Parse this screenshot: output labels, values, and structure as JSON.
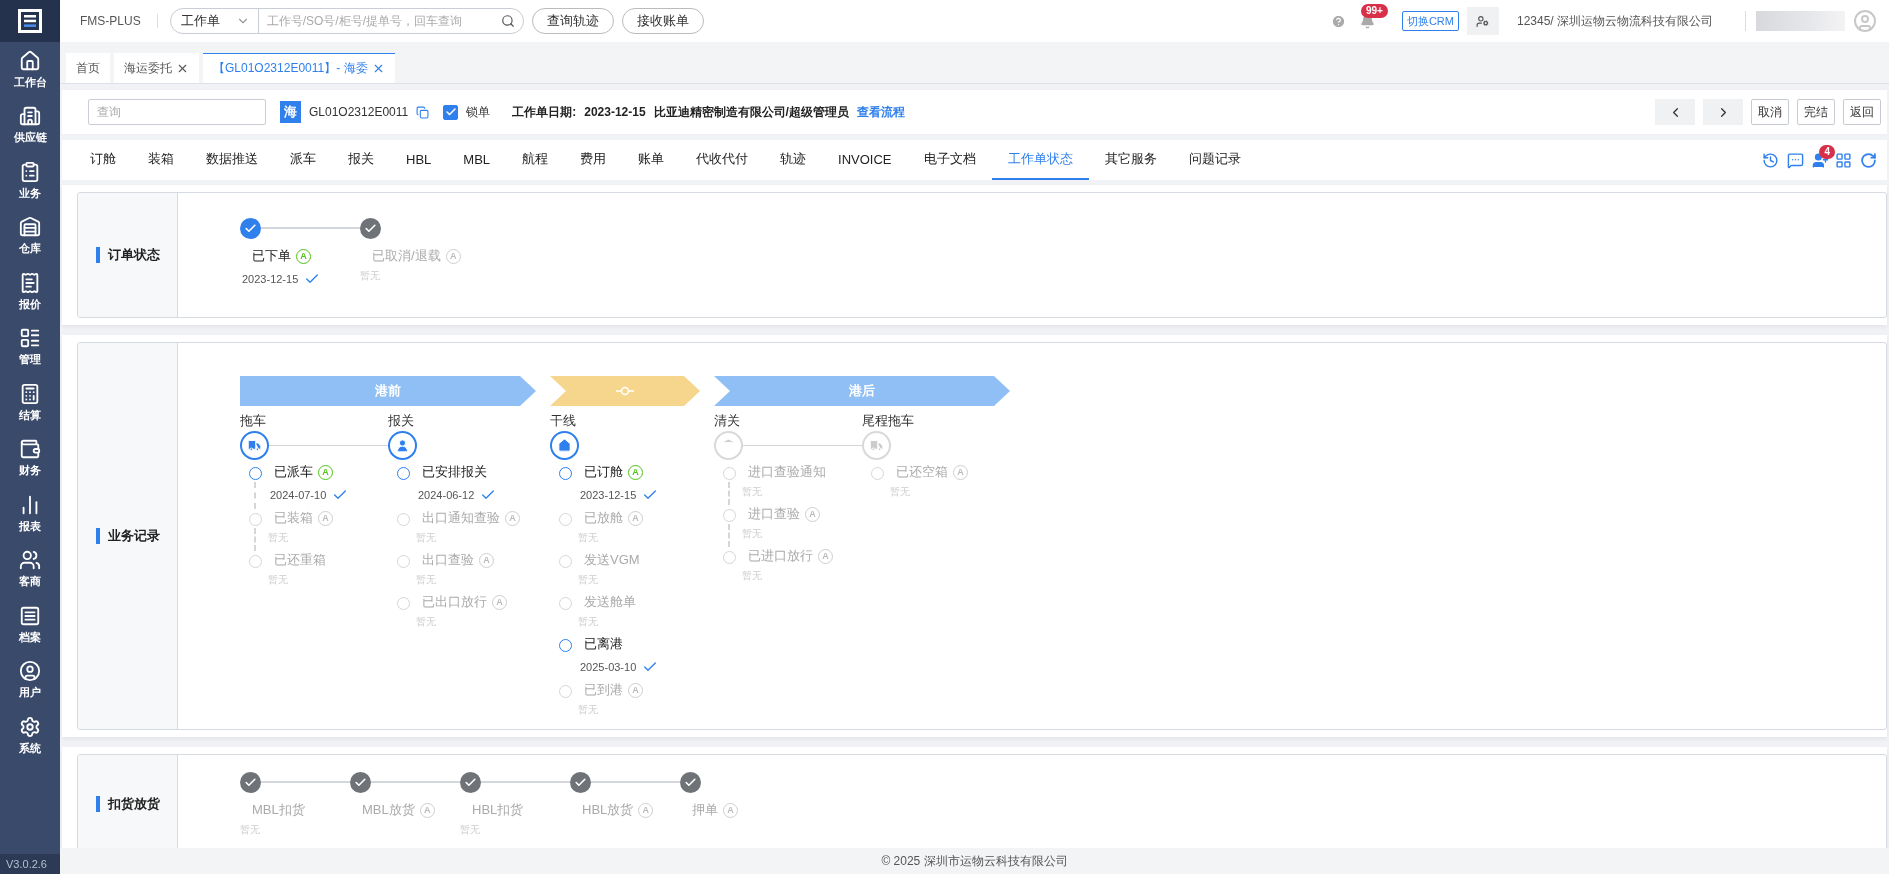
{
  "sidebar": {
    "items": [
      {
        "label": "工作台"
      },
      {
        "label": "供应链"
      },
      {
        "label": "业务"
      },
      {
        "label": "仓库"
      },
      {
        "label": "报价"
      },
      {
        "label": "管理"
      },
      {
        "label": "结算"
      },
      {
        "label": "财务"
      },
      {
        "label": "报表"
      },
      {
        "label": "客商"
      },
      {
        "label": "档案"
      },
      {
        "label": "用户"
      },
      {
        "label": "系统"
      }
    ],
    "version": "V3.0.2.6"
  },
  "header": {
    "app_name": "FMS-PLUS",
    "search": {
      "scope": "工作单",
      "placeholder": "工作号/SO号/柜号/提单号，回车查询"
    },
    "buttons": [
      "查询轨迹",
      "接收账单"
    ],
    "notification_count": "99+",
    "crm_button": "切换CRM",
    "user": "12345/ 深圳运物云物流科技有限公司"
  },
  "page_tabs": [
    {
      "label": "首页",
      "selected": false,
      "closable": false
    },
    {
      "label": "海运委托",
      "selected": false,
      "closable": true
    },
    {
      "label": "【GL01O2312E0011】- 海委",
      "selected": true,
      "closable": true
    }
  ],
  "toolbar": {
    "search_placeholder": "查询",
    "mode_badge": "海",
    "order_no": "GL01O2312E0011",
    "lock": {
      "label": "锁单",
      "checked": true
    },
    "date_label": "工作单日期:",
    "date": "2023-12-15",
    "company": "比亚迪精密制造有限公司/超级管理员",
    "flow_link": "查看流程",
    "buttons": [
      "取消",
      "完结",
      "返回"
    ]
  },
  "nav_tabs": [
    {
      "label": "订舱",
      "selected": false
    },
    {
      "label": "装箱",
      "selected": false
    },
    {
      "label": "数据推送",
      "selected": false
    },
    {
      "label": "派车",
      "selected": false
    },
    {
      "label": "报关",
      "selected": false
    },
    {
      "label": "HBL",
      "selected": false
    },
    {
      "label": "MBL",
      "selected": false
    },
    {
      "label": "航程",
      "selected": false
    },
    {
      "label": "费用",
      "selected": false
    },
    {
      "label": "账单",
      "selected": false
    },
    {
      "label": "代收代付",
      "selected": false
    },
    {
      "label": "轨迹",
      "selected": false
    },
    {
      "label": "INVOICE",
      "selected": false
    },
    {
      "label": "电子文档",
      "selected": false
    },
    {
      "label": "工作单状态",
      "selected": true
    },
    {
      "label": "其它服务",
      "selected": false
    },
    {
      "label": "问题记录",
      "selected": false
    }
  ],
  "nav_badge": "4",
  "order_status": {
    "title": "订单状态",
    "steps": [
      {
        "label": "已下单",
        "selected": true,
        "badge": "A",
        "date": "2023-12-15"
      },
      {
        "label": "已取消/退载",
        "selected": false,
        "badge": "A",
        "note": "暂无"
      }
    ]
  },
  "business_records": {
    "title": "业务记录",
    "phases": [
      {
        "label": "港前",
        "color": "#8fbff5",
        "nodes": [
          {
            "label": "拖车",
            "active": true,
            "linked": true,
            "events": [
              {
                "label": "已派车",
                "done": true,
                "badge": "A",
                "date": "2024-07-10"
              },
              {
                "label": "已装箱",
                "done": false,
                "badge": "A",
                "note": "暂无"
              },
              {
                "label": "已还重箱",
                "done": false,
                "note": "暂无"
              }
            ]
          },
          {
            "label": "报关",
            "active": true,
            "linked": false,
            "events": [
              {
                "label": "已安排报关",
                "done": true,
                "date": "2024-06-12"
              },
              {
                "label": "出口通知查验",
                "done": false,
                "badge": "A",
                "note": "暂无"
              },
              {
                "label": "出口查验",
                "done": false,
                "badge": "A",
                "note": "暂无"
              },
              {
                "label": "已出口放行",
                "done": false,
                "badge": "A",
                "note": "暂无"
              }
            ]
          }
        ]
      },
      {
        "color": "#f6d58d",
        "nodes": [
          {
            "label": "干线",
            "active": true,
            "linked": false,
            "events": [
              {
                "label": "已订舱",
                "done": true,
                "badge": "A",
                "date": "2023-12-15"
              },
              {
                "label": "已放舱",
                "done": false,
                "badge": "A",
                "note": "暂无"
              },
              {
                "label": "发送VGM",
                "done": false,
                "note": "暂无"
              },
              {
                "label": "发送舱单",
                "done": false,
                "note": "暂无"
              },
              {
                "label": "已离港",
                "done": true,
                "date": "2025-03-10"
              },
              {
                "label": "已到港",
                "done": false,
                "badge": "A",
                "note": "暂无"
              }
            ]
          }
        ]
      },
      {
        "label": "港后",
        "color": "#8fbff5",
        "nodes": [
          {
            "label": "清关",
            "active": false,
            "linked": true,
            "events": [
              {
                "label": "进口查验通知",
                "done": false,
                "note": "暂无"
              },
              {
                "label": "进口查验",
                "done": false,
                "badge": "A",
                "note": "暂无"
              },
              {
                "label": "已进口放行",
                "done": false,
                "badge": "A",
                "note": "暂无"
              }
            ]
          },
          {
            "label": "尾程拖车",
            "active": false,
            "events": [
              {
                "label": "已还空箱",
                "done": false,
                "badge": "A",
                "note": "暂无"
              }
            ]
          }
        ]
      }
    ]
  },
  "hold_release": {
    "title": "扣货放货",
    "steps": [
      {
        "label": "MBL扣货",
        "selected": false,
        "note": "暂无"
      },
      {
        "label": "MBL放货",
        "selected": false,
        "badge": "A"
      },
      {
        "label": "HBL扣货",
        "selected": false,
        "note": "暂无"
      },
      {
        "label": "HBL放货",
        "selected": false,
        "badge": "A"
      },
      {
        "label": "押单",
        "selected": false,
        "badge": "A"
      }
    ]
  },
  "footer": "© 2025 深圳市运物云科技有限公司"
}
